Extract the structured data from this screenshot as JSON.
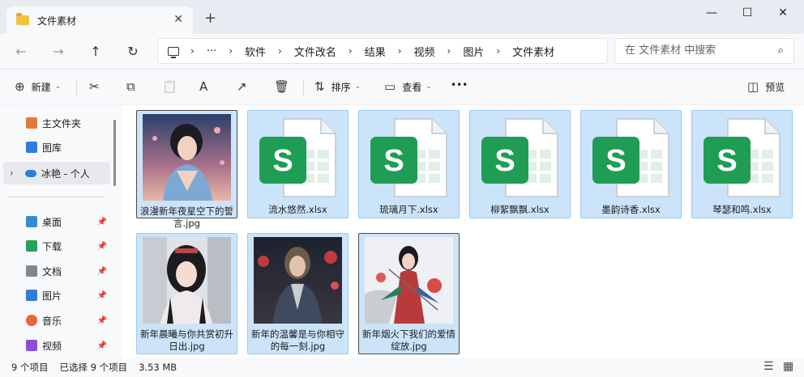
{
  "tab": {
    "title": "文件素材",
    "close": "✕",
    "new": "+"
  },
  "window": {
    "minimize": "—",
    "maximize": "☐",
    "close": "✕"
  },
  "nav": {
    "back": "←",
    "forward": "→",
    "up": "↑",
    "refresh": "↻"
  },
  "address": {
    "more": "···",
    "breadcrumbs": [
      "软件",
      "文件改名",
      "结果",
      "视频",
      "图片",
      "文件素材"
    ],
    "sep": "›"
  },
  "search": {
    "placeholder": "在 文件素材 中搜索",
    "icon": "⌕"
  },
  "commands": {
    "new_label": "新建",
    "sort_label": "排序",
    "view_label": "查看",
    "more": "•••",
    "preview_label": "预览",
    "new_icon": "⊕",
    "cut_icon": "✂",
    "copy_icon": "⧉",
    "paste_icon": "📋",
    "rename_icon": "A",
    "share_icon": "↗",
    "delete_icon": "🗑",
    "sort_icon": "⇅",
    "view_icon": "▭",
    "preview_icon": "◫",
    "caret": "⌄"
  },
  "sidebar": {
    "home": "主文件夹",
    "gallery": "图库",
    "cloud": "冰艳 - 个人",
    "pinned": [
      {
        "label": "桌面",
        "color": "#2f8fd8"
      },
      {
        "label": "下载",
        "color": "#2aa05a"
      },
      {
        "label": "文档",
        "color": "#7c8794"
      },
      {
        "label": "图片",
        "color": "#2f7dd8"
      },
      {
        "label": "音乐",
        "color": "#e8663d"
      },
      {
        "label": "视频",
        "color": "#8b4fd6"
      }
    ],
    "pin": "📌",
    "expand": "›"
  },
  "files": [
    {
      "name": "浪漫新年夜星空下的誓言.jpg",
      "type": "image"
    },
    {
      "name": "流水悠然.xlsx",
      "type": "xlsx"
    },
    {
      "name": "琉璃月下.xlsx",
      "type": "xlsx"
    },
    {
      "name": "柳絮飘飘.xlsx",
      "type": "xlsx"
    },
    {
      "name": "墨韵诗香.xlsx",
      "type": "xlsx"
    },
    {
      "name": "琴瑟和鸣.xlsx",
      "type": "xlsx"
    },
    {
      "name": "新年晨曦与你共赏初升日出.jpg",
      "type": "image"
    },
    {
      "name": "新年的温馨是与你相守的每一刻.jpg",
      "type": "image"
    },
    {
      "name": "新年烟火下我们的爱情绽放.jpg",
      "type": "image"
    }
  ],
  "status": {
    "count": "9 个项目",
    "selected": "已选择 9 个项目",
    "size": "3.53 MB",
    "details_icon": "☰",
    "tiles_icon": "▦"
  },
  "colors": {
    "selection": "#cce4fa",
    "excel_green": "#1f9d55"
  }
}
